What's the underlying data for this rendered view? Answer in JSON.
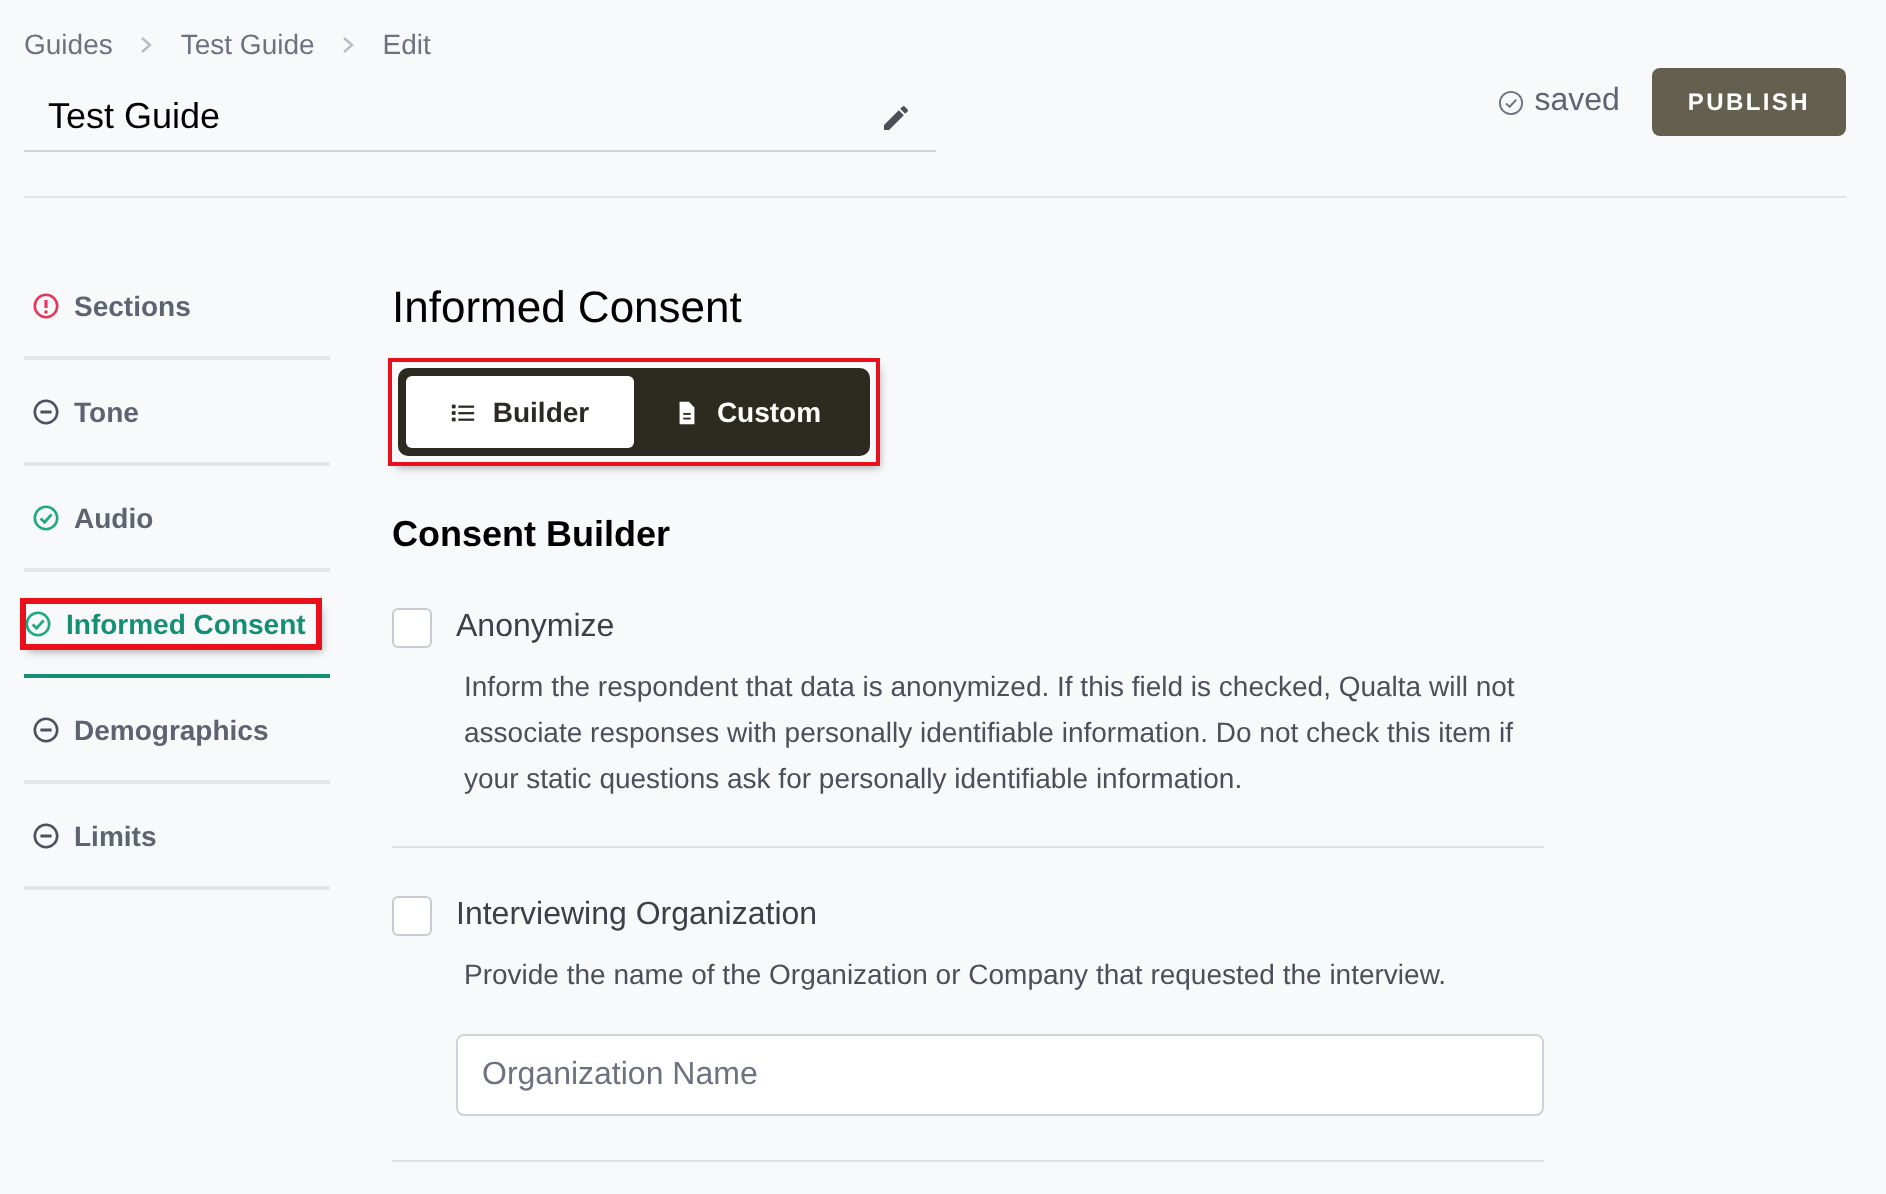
{
  "breadcrumbs": [
    {
      "label": "Guides"
    },
    {
      "label": "Test Guide"
    },
    {
      "label": "Edit"
    }
  ],
  "guide_title": "Test Guide",
  "save_status": "saved",
  "publish_button": "PUBLISH",
  "sidebar": {
    "items": [
      {
        "label": "Sections",
        "kind": "error",
        "selected": false,
        "highlighted": false
      },
      {
        "label": "Tone",
        "kind": "pending",
        "selected": false,
        "highlighted": false
      },
      {
        "label": "Audio",
        "kind": "done",
        "selected": false,
        "highlighted": false
      },
      {
        "label": "Informed Consent",
        "kind": "done",
        "selected": true,
        "highlighted": true
      },
      {
        "label": "Demographics",
        "kind": "pending",
        "selected": false,
        "highlighted": false
      },
      {
        "label": "Limits",
        "kind": "pending",
        "selected": false,
        "highlighted": false
      }
    ]
  },
  "heading": "Informed Consent",
  "mode_toggle": {
    "highlighted": true,
    "options": [
      {
        "label": "Builder",
        "kind": "list",
        "selected": true
      },
      {
        "label": "Custom",
        "kind": "document",
        "selected": false
      }
    ]
  },
  "builder_title": "Consent Builder",
  "options": [
    {
      "label": "Anonymize",
      "checked": false,
      "description": "Inform the respondent that data is anonymized. If this field is checked, Qualta will not associate responses with personally identifiable information. Do not check this item if your static questions ask for personally identifiable information."
    },
    {
      "label": "Interviewing Organization",
      "checked": false,
      "description": "Provide the name of the Organization or Company that requested the interview.",
      "placeholder": "Organization Name"
    }
  ]
}
